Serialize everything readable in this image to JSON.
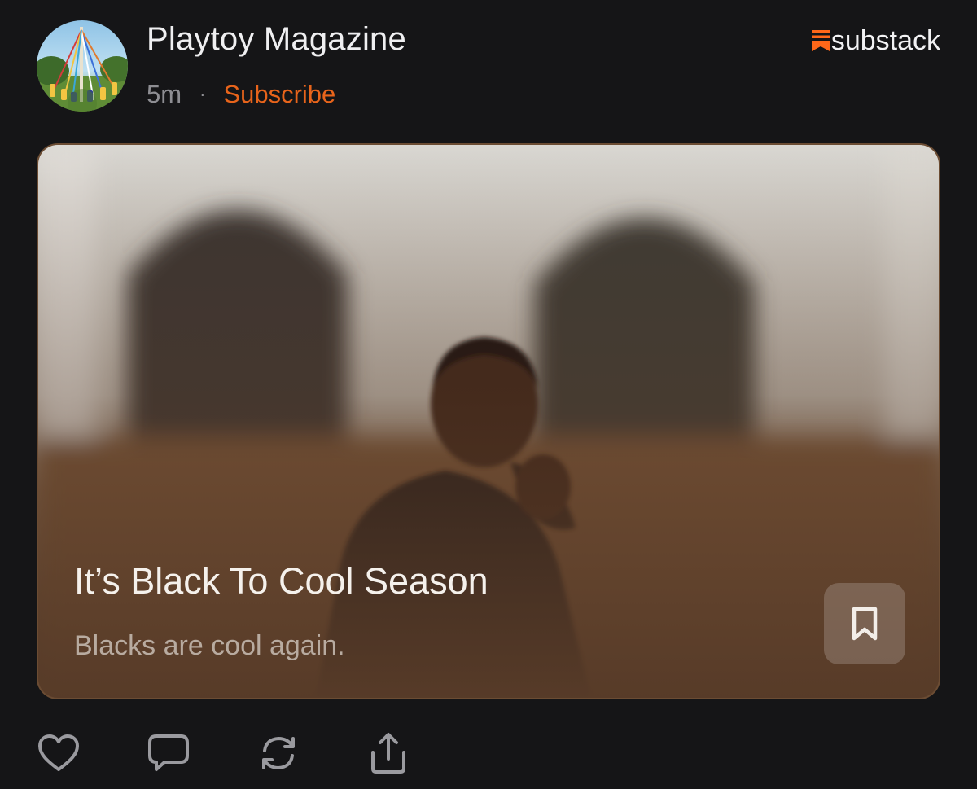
{
  "post": {
    "publication_name": "Playtoy Magazine",
    "time_ago": "5m",
    "separator": "·",
    "subscribe_label": "Subscribe",
    "brand": "substack"
  },
  "card": {
    "title": "It’s Black To Cool Season",
    "subtitle": "Blacks are cool again."
  },
  "icons": {
    "avatar": "maypole-avatar",
    "logo": "substack-logo-icon",
    "bookmark": "bookmark-icon",
    "like": "heart-icon",
    "comment": "comment-icon",
    "restack": "restack-icon",
    "share": "share-icon"
  },
  "colors": {
    "background": "#151517",
    "accent": "#e8641b",
    "card_tint": "#573b28"
  }
}
